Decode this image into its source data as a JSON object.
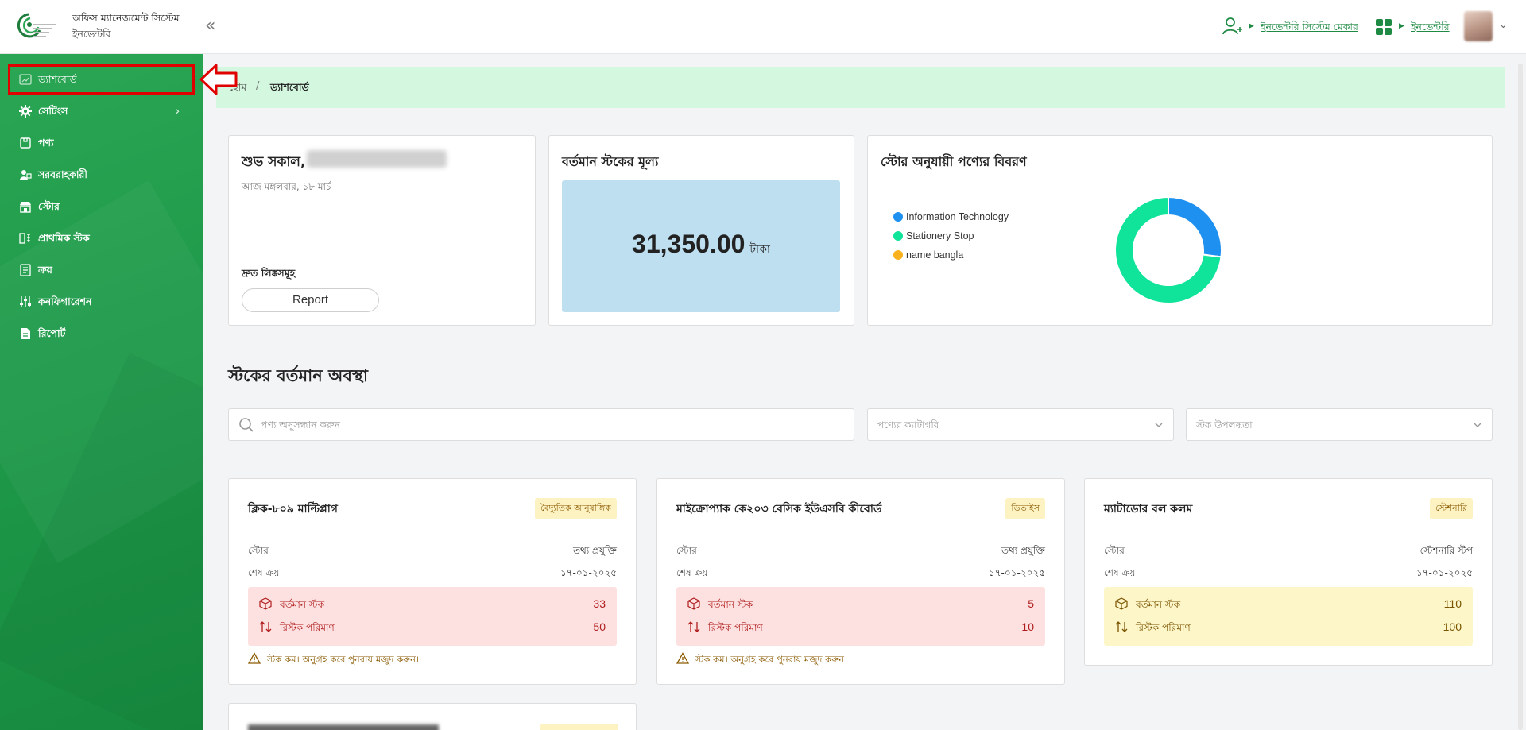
{
  "header": {
    "org_title": "অফিস ম্যানেজমেন্ট সিস্টেম",
    "org_subtitle": "ইনভেন্টরি",
    "role_link": "ইনভেন্টরি সিস্টেম মেকার",
    "module_link": "ইনভেন্টরি",
    "colors": {
      "brand_green": "#1f8a44"
    }
  },
  "sidebar": {
    "items": [
      {
        "label": "ড্যাশবোর্ড",
        "icon": "dashboard-icon",
        "active": true
      },
      {
        "label": "সেটিংস",
        "icon": "settings-gear-icon",
        "has_submenu": true
      },
      {
        "label": "পণ্য",
        "icon": "product-icon"
      },
      {
        "label": "সরবরাহকারী",
        "icon": "supplier-icon"
      },
      {
        "label": "স্টোর",
        "icon": "store-icon"
      },
      {
        "label": "প্রাথমিক স্টক",
        "icon": "initial-stock-icon"
      },
      {
        "label": "ক্রয়",
        "icon": "purchase-icon"
      },
      {
        "label": "কনফিগারেশন",
        "icon": "configuration-icon"
      },
      {
        "label": "রিপোর্ট",
        "icon": "report-icon"
      }
    ],
    "colors": {
      "background": "#1f9a4a"
    }
  },
  "breadcrumb": {
    "home": "হোম",
    "separator": "/",
    "current": "ড্যাশবোর্ড"
  },
  "welcome": {
    "greeting": "শুভ সকাল,",
    "date_text": "আজ মঙ্গলবার, ১৮ মার্চ",
    "quick_links_title": "দ্রুত লিঙ্কসমূহ",
    "report_button": "Report"
  },
  "stock_value": {
    "title": "বর্তমান স্টকের মূল্য",
    "amount": "31,350.00",
    "currency": "টাকা"
  },
  "store_chart": {
    "title": "স্টোর অনুযায়ী পণ্যের বিবরণ"
  },
  "chart_data": {
    "type": "pie",
    "title": "স্টোর অনুযায়ী পণ্যের বিবরণ",
    "labels": [
      "Information Technology",
      "Stationery Stop",
      "name bangla"
    ],
    "values": [
      27,
      73,
      0
    ],
    "colors": [
      "#1e90f0",
      "#10e39a",
      "#f9b21d"
    ],
    "donut": true,
    "legend": "left"
  },
  "stock_status": {
    "title": "স্টকের বর্তমান অবস্থা",
    "search_placeholder": "পণ্য অনুসন্ধান করুন",
    "category_placeholder": "পণ্যের ক্যাটাগরি",
    "availability_placeholder": "স্টক উপলব্ধতা",
    "store_label": "স্টোর",
    "last_purchase_label": "শেষ ক্রয়",
    "current_stock_label": "বর্তমান স্টক",
    "restock_label": "রিস্টক পরিমাণ",
    "low_stock_warning": "স্টক কম। অনুগ্রহ করে পুনরায় মজুদ করুন।",
    "products": [
      {
        "name": "ক্লিক-৮০৯ মাল্টিপ্লাগ",
        "badge": "বৈদ্যুতিক আনুষাঙ্গিক",
        "store": "তথ্য প্রযুক্তি",
        "last_purchase": "১৭-০১-২০২৫",
        "current_stock": "33",
        "restock": "50",
        "low": true
      },
      {
        "name": "মাইক্রোপ্যাক কে২০৩ বেসিক ইউএসবি কীবোর্ড",
        "badge": "ডিভাইস",
        "store": "তথ্য প্রযুক্তি",
        "last_purchase": "১৭-০১-২০২৫",
        "current_stock": "5",
        "restock": "10",
        "low": true
      },
      {
        "name": "ম্যাটাডোর বল কলম",
        "badge": "স্টেশনারি",
        "store": "স্টেশনারি স্টপ",
        "last_purchase": "১৭-০১-২০২৫",
        "current_stock": "110",
        "restock": "100",
        "low": false
      }
    ]
  }
}
